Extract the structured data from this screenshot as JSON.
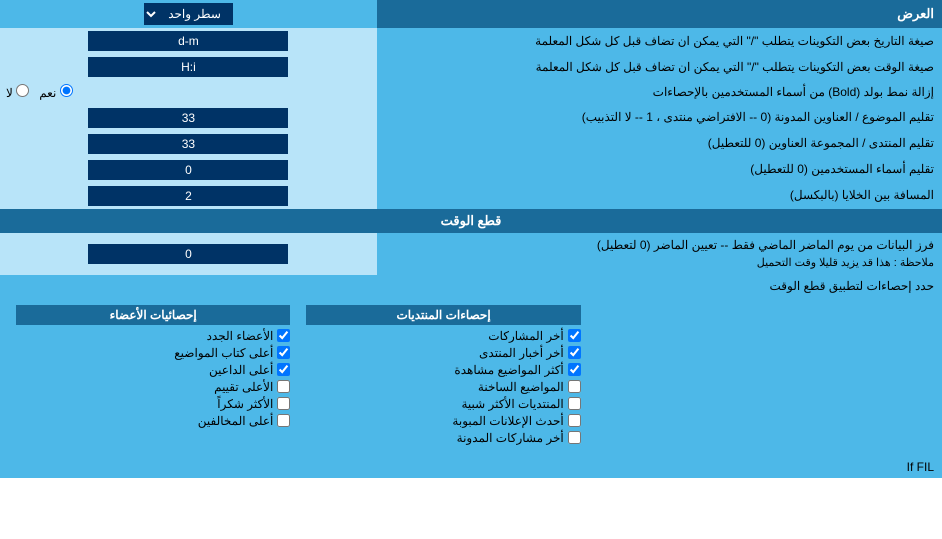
{
  "header": {
    "display_label": "العرض",
    "single_line_label": "سطر واحد"
  },
  "rows": [
    {
      "label": "صيغة التاريخ\nبعض التكوينات يتطلب \"/\" التي يمكن ان تضاف قبل كل شكل المعلمة",
      "value": "d-m",
      "type": "input"
    },
    {
      "label": "صيغة الوقت\nبعض التكوينات يتطلب \"/\" التي يمكن ان تضاف قبل كل شكل المعلمة",
      "value": "H:i",
      "type": "input"
    },
    {
      "label": "إزالة نمط بولد (Bold) من أسماء المستخدمين بالإحصاءات",
      "type": "radio",
      "options": [
        "نعم",
        "لا"
      ],
      "selected": "نعم"
    },
    {
      "label": "تقليم الموضوع / العناوين المدونة (0 -- الافتراضي منتدى ، 1 -- لا التذبيب)",
      "value": "33",
      "type": "input"
    },
    {
      "label": "تقليم المنتدى / المجموعة العناوين (0 للتعطيل)",
      "value": "33",
      "type": "input"
    },
    {
      "label": "تقليم أسماء المستخدمين (0 للتعطيل)",
      "value": "0",
      "type": "input"
    },
    {
      "label": "المسافة بين الخلايا (بالبكسل)",
      "value": "2",
      "type": "input"
    }
  ],
  "section_cutoff": {
    "title": "قطع الوقت",
    "cutoff_row": {
      "label": "فرز البيانات من يوم الماضر الماضي فقط -- تعيين الماضر (0 لتعطيل)\nملاحظة : هذا قد يزيد قليلا وقت التحميل",
      "value": "0"
    },
    "limit_label": "حدد إحصاءات لتطبيق قطع الوقت"
  },
  "checkboxes": {
    "col1": {
      "header": "إحصائيات الأعضاء",
      "items": [
        "الأعضاء الجدد",
        "أعلى كتاب المواضيع",
        "أعلى الداعين",
        "الأعلى تقييم",
        "الأكثر شكرا",
        "أعلى المخالفين"
      ]
    },
    "col2": {
      "header": "إحصاءات المنتديات",
      "items": [
        "أخر المشاركات",
        "أخر أخبار المنتدى",
        "أكثر المواضيع مشاهدة",
        "المواضيع الساخنة",
        "المنتديات الأكثر شبية",
        "أحدث الإعلانات المبوبة",
        "أخر مشاركات المدونة"
      ]
    }
  },
  "labels": {
    "yes": "نعم",
    "no": "لا",
    "if_fil": "If FIL"
  }
}
